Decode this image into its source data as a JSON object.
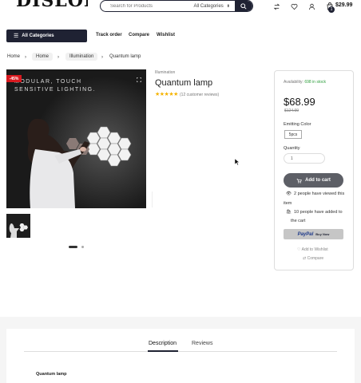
{
  "header": {
    "logo_text": "DISLOBA",
    "search_placeholder": "Search for Products",
    "search_category": "All Categories",
    "icons": [
      "compare-icon",
      "heart-icon",
      "user-icon",
      "cart-icon"
    ],
    "cart_price": "$29.99",
    "cart_count": "1"
  },
  "nav": {
    "all_categories": "All Categories",
    "links": [
      "Track order",
      "Compare",
      "Wishlist"
    ]
  },
  "breadcrumb": [
    "Home",
    "Home",
    "Illumination",
    "Quantum lamp"
  ],
  "gallery": {
    "sale_badge": "-45%",
    "image_caption_line1": "MODULAR, TOUCH",
    "image_caption_line2": "SENSITIVE LIGHTING.",
    "slides": 2,
    "active_slide": 1
  },
  "product": {
    "category": "Illumination",
    "title": "Quantum lamp",
    "rating": 5,
    "stars": "★★★★★",
    "reviews": "(12 customer reviews)"
  },
  "buybox": {
    "availability_label": "Availability:",
    "availability_value": "698 in stock",
    "price": "$68.99",
    "old_price": "$124.99",
    "color_label": "Emitting Color",
    "color_option": "5pcs",
    "quantity_label": "Quantity",
    "quantity_value": "1",
    "add_to_cart": "Add to cart",
    "viewed_text_1": "2 people have viewed this",
    "viewed_text_2": "item",
    "added_text_1": "10 people have added to",
    "added_text_2": "the cart",
    "paypal_logo": "PayPal",
    "paypal_label": "Buy Now",
    "wishlist": "Add to Wishlist",
    "compare": "Compare"
  },
  "tabs": {
    "items": [
      "Description",
      "Reviews"
    ],
    "active": "Description",
    "content_title": "Quantum lamp"
  },
  "colors": {
    "primary": "#1f2233",
    "sale": "#d9191f",
    "in_stock": "#2e9e3d",
    "star": "#f5b301"
  }
}
